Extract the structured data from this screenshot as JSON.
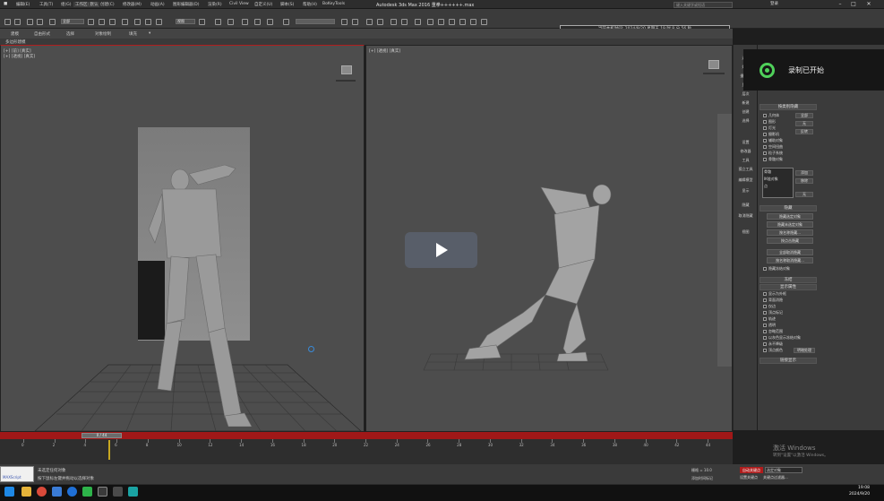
{
  "titlebar": {
    "menus": [
      "编辑(E)",
      "工具(T)",
      "组(G)",
      "视图(V)",
      "创建(C)",
      "修改器(M)",
      "动画(A)",
      "图形编辑器(D)",
      "渲染(R)",
      "Civil View",
      "自定义(U)",
      "脚本(S)",
      "帮助(H)",
      "BoKeyTools"
    ],
    "workspace": "工作区: 默认",
    "app_title": "Autodesk 3ds Max 2016    重拳++++++.max",
    "search_placeholder": "键入关键字或短语",
    "user": "登录"
  },
  "toolbar": {
    "filter_value": "全部",
    "view_value": "视图",
    "time_banner": "当前本机时间:  2024/9/20  星期五   19 时 8 分 56 秒"
  },
  "ribbon": {
    "tabs": [
      "建模",
      "自由形式",
      "选择",
      "对象绘制",
      "填充"
    ],
    "subtitle": "多边形建模"
  },
  "viewport_left": {
    "label_line1": "[+] [前] [真实]",
    "label_line2": "[+] [透视] [真实]"
  },
  "viewport_right": {
    "label": "[+] [透视] [真实]"
  },
  "recording": {
    "text": "录制已开始"
  },
  "command_sidebar": {
    "items": [
      "选择",
      "灯光",
      "摄影机",
      "显示",
      "层次",
      "新建",
      "创建",
      "选择",
      "设置",
      "修改器",
      "工具",
      "孤立工具",
      "编辑模型",
      "显示",
      "隐藏",
      "取消隐藏",
      "视图"
    ]
  },
  "command_panel": {
    "display_label": "按类别隐藏",
    "hide_by_category": [
      "几何体",
      "图形",
      "灯光",
      "摄影机",
      "辅助对象",
      "空间扭曲",
      "粒子系统",
      "骨骼对象"
    ],
    "side_buttons": [
      "全部",
      "无",
      "反转"
    ],
    "list_items": [
      "骨骼",
      "IK链对象",
      "点"
    ],
    "add_button": "添加",
    "remove_button": "移除",
    "none_button": "无",
    "hide_rollout": "隐藏",
    "hide_buttons": [
      "隐藏选定对象",
      "隐藏未选定对象",
      "按名称隐藏...",
      "按点击隐藏"
    ],
    "unhide_buttons": [
      "全部取消隐藏",
      "按名称取消隐藏..."
    ],
    "hide_frozen": "隐藏冻结对象",
    "freeze_rollout": "冻结",
    "display_props_rollout": "显示属性",
    "display_props": [
      "显示为外框",
      "背面消隐",
      "仅边",
      "顶点标记",
      "轨迹",
      "透明",
      "忽略范围",
      "以灰色显示冻结对象",
      "永不降级",
      "顶点颜色"
    ],
    "shade_button": "明暗处理",
    "link_display_rollout": "链接显示"
  },
  "timeline": {
    "slider_label": "0 / 44",
    "ticks": [
      "0",
      "2",
      "4",
      "6",
      "8",
      "10",
      "12",
      "14",
      "16",
      "18",
      "20",
      "22",
      "24",
      "26",
      "28",
      "30",
      "32",
      "34",
      "36",
      "38",
      "40",
      "42",
      "44"
    ]
  },
  "statusbar": {
    "line1": "未选定任何对象",
    "line2": "按下鼠标左键并拖动以选择对象",
    "script_label": "MAXScript",
    "grid": "栅格 = 10.0",
    "add_time_tag": "添加时间标记",
    "auto_key": "自动关键点",
    "selected_dropdown": "选定对象",
    "set_key": "设置关键点",
    "key_filters": "关键点过滤器...",
    "win_activate_title": "激活 Windows",
    "win_activate_sub": "转到\"设置\"以激活 Windows。"
  },
  "taskbar": {
    "time": "19:08",
    "date": "2024/9/20"
  },
  "colors": {
    "accent_red": "#a01818",
    "record_green": "#4fd05a",
    "key_marker": "#c8a821"
  }
}
